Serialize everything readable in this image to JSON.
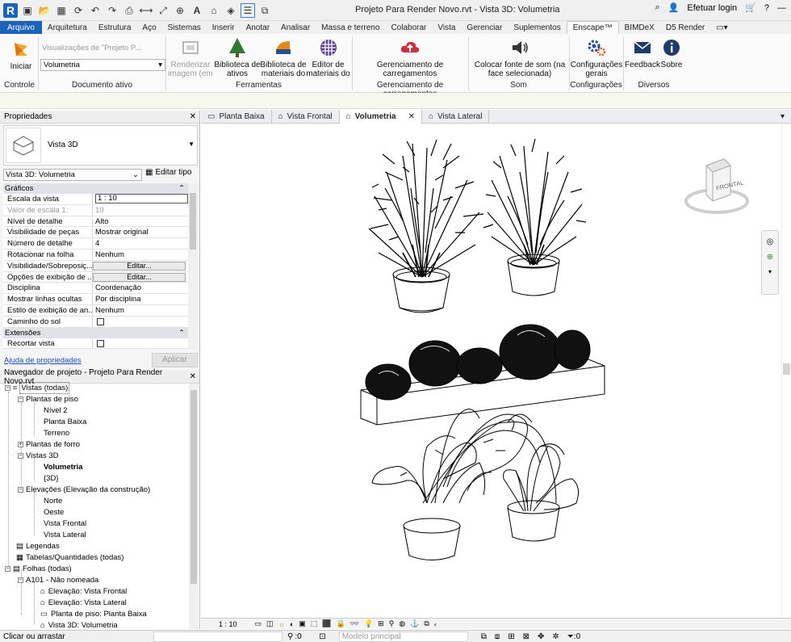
{
  "titlebar": {
    "title": "Projeto Para Render Novo.rvt - Vista 3D: Volumetria",
    "login": "Efetuar login"
  },
  "ribbon_tabs": [
    "Arquivo",
    "Arquitetura",
    "Estrutura",
    "Aço",
    "Sistemas",
    "Inserir",
    "Anotar",
    "Analisar",
    "Massa e terreno",
    "Colaborar",
    "Vista",
    "Gerenciar",
    "Suplementos",
    "Enscape™",
    "BIMDeX",
    "D5 Render"
  ],
  "ribbon": {
    "iniciar": "Iniciar",
    "visualizacoes_placeholder": "Visualizações de \"Projeto P...",
    "view_select": "Volumetria",
    "renderizar": [
      "Renderizar",
      "imagem (em"
    ],
    "biblioteca_ativos": [
      "Biblioteca de",
      "ativos"
    ],
    "biblioteca_materiais": [
      "Biblioteca de",
      "materiais do"
    ],
    "editor_materiais": [
      "Editor de",
      "materiais do"
    ],
    "gerenciamento": [
      "Gerenciamento de",
      "carregamentos"
    ],
    "som": [
      "Colocar fonte de som (na",
      "face selecionada)"
    ],
    "configuracoes": [
      "Configurações",
      "gerais"
    ],
    "feedback": "Feedback",
    "sobre": "Sobre",
    "groups": {
      "controle": "Controle",
      "documento": "Documento ativo",
      "ferramentas": "Ferramentas",
      "gerenciamento": "Gerenciamento de carregamentos",
      "som": "Som",
      "configuracoes": "Configurações",
      "diversos": "Diversos"
    }
  },
  "properties": {
    "title": "Propriedades",
    "type_name": "Vista 3D",
    "instance_select": "Vista 3D: Volumetria",
    "edit_type": "Editar tipo",
    "cat_graficos": "Gráficos",
    "cat_extensoes": "Extensões",
    "rows": [
      {
        "k": "Escala da vista",
        "v": "1 : 10"
      },
      {
        "k": "Valor de escala    1:",
        "v": "10"
      },
      {
        "k": "Nível de detalhe",
        "v": "Alto"
      },
      {
        "k": "Visibilidade de peças",
        "v": "Mostrar original"
      },
      {
        "k": "Número de detalhe",
        "v": "4"
      },
      {
        "k": "Rotacionar na folha",
        "v": "Nenhum"
      },
      {
        "k": "Visibilidade/Sobreposiç...",
        "v": "Editar..."
      },
      {
        "k": "Opções de exibição de ...",
        "v": "Editar..."
      },
      {
        "k": "Disciplina",
        "v": "Coordenação"
      },
      {
        "k": "Mostrar linhas ocultas",
        "v": "Por disciplina"
      },
      {
        "k": "Estilo de exibição de an...",
        "v": "Nenhum"
      },
      {
        "k": "Caminho do sol",
        "v": ""
      }
    ],
    "recortar": "Recortar vista",
    "help_link": "Ajuda de propriedades",
    "apply": "Aplicar"
  },
  "browser": {
    "title": "Navegador de projeto - Projeto Para Render Novo.rvt",
    "items": [
      "Vistas (todas)",
      "Plantas de piso",
      "Nível 2",
      "Planta Baixa",
      "Terreno",
      "Plantas de forro",
      "Vistas 3D",
      "Volumetria",
      "{3D}",
      "Elevações (Elevação da construção)",
      "Norte",
      "Oeste",
      "Vista Frontal",
      "Vista Lateral",
      "Legendas",
      "Tabelas/Quantidades (todas)",
      "Folhas (todas)",
      "A101 - Não nomeada",
      "Elevação: Vista Frontal",
      "Elevação: Vista Lateral",
      "Planta de piso: Planta Baixa",
      "Vista 3D: Volumetria"
    ]
  },
  "view_tabs": [
    "Planta Baixa",
    "Vista Frontal",
    "Volumetria",
    "Vista Lateral"
  ],
  "viewcube_label": "FRONTAL",
  "viewbar": {
    "scale": "1 : 10"
  },
  "status": {
    "hint": "Clicar ou arrastar",
    "count": ":0",
    "model": "Modelo principal"
  }
}
